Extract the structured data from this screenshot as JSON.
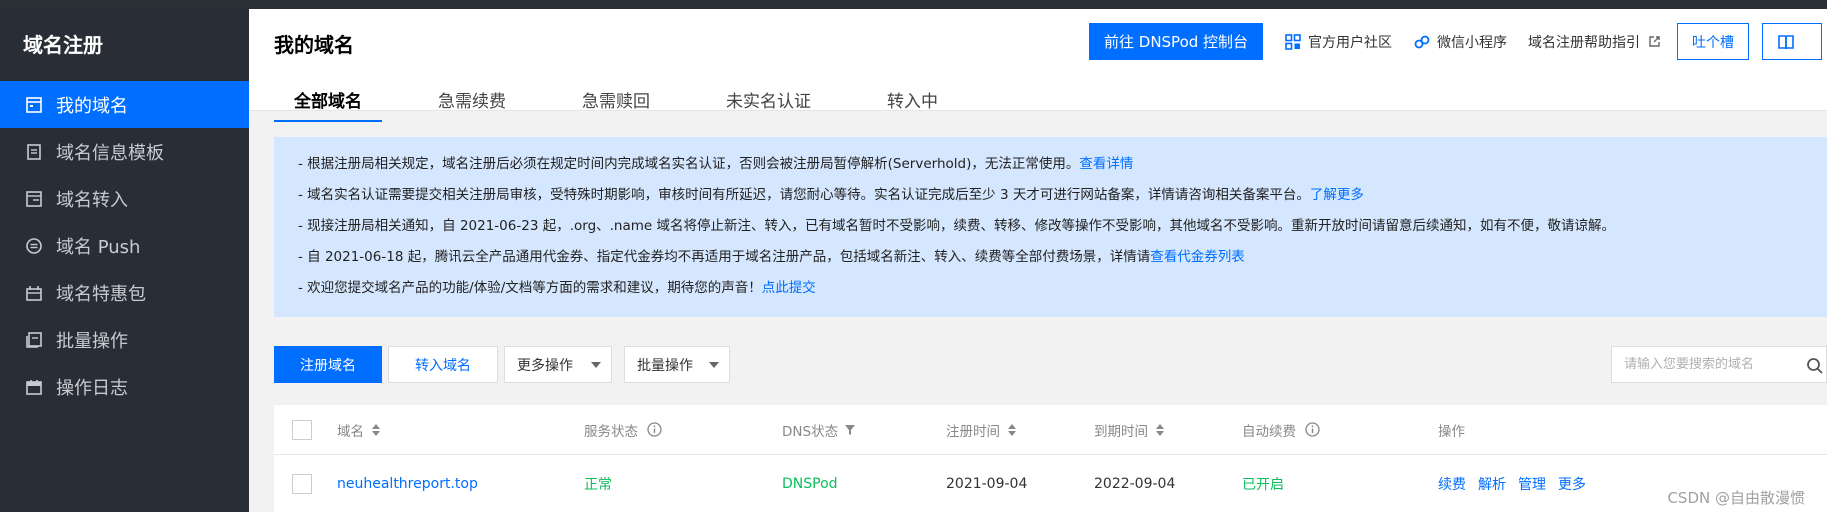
{
  "sidebar": {
    "title": "域名注册",
    "items": [
      {
        "label": "我的域名",
        "icon": "domain-list-icon",
        "active": true
      },
      {
        "label": "域名信息模板",
        "icon": "document-icon",
        "active": false
      },
      {
        "label": "域名转入",
        "icon": "transfer-icon",
        "active": false
      },
      {
        "label": "域名 Push",
        "icon": "push-icon",
        "active": false
      },
      {
        "label": "域名特惠包",
        "icon": "gift-icon",
        "active": false
      },
      {
        "label": "批量操作",
        "icon": "batch-icon",
        "active": false
      },
      {
        "label": "操作日志",
        "icon": "calendar-icon",
        "active": false
      }
    ]
  },
  "header": {
    "title": "我的域名",
    "tabs": [
      "全部域名",
      "急需续费",
      "急需赎回",
      "未实名认证",
      "转入中"
    ],
    "active_tab": 0,
    "dnspod_button": "前往 DNSPod 控制台",
    "community_link": "官方用户社区",
    "miniprogram_link": "微信小程序",
    "help_link": "域名注册帮助指引",
    "feedback_button": "吐个槽"
  },
  "notice": {
    "lines": [
      {
        "text": "- 根据注册局相关规定，域名注册后必须在规定时间内完成域名实名认证，否则会被注册局暂停解析(Serverhold)，无法正常使用。",
        "link": "查看详情"
      },
      {
        "text": "- 域名实名认证需要提交相关注册局审核，受特殊时期影响，审核时间有所延迟，请您耐心等待。实名认证完成后至少 3 天才可进行网站备案，详情请咨询相关备案平台。",
        "link": "了解更多"
      },
      {
        "text": "- 现接注册局相关通知，自 2021-06-23 起，.org、.name 域名将停止新注、转入，已有域名暂时不受影响，续费、转移、修改等操作不受影响，其他域名不受影响。重新开放时间请留意后续通知，如有不便，敬请谅解。",
        "link": ""
      },
      {
        "text": "- 自 2021-06-18 起，腾讯云全产品通用代金券、指定代金券均不再适用于域名注册产品，包括域名新注、转入、续费等全部付费场景，详情请",
        "link": "查看代金券列表"
      },
      {
        "text": "- 欢迎您提交域名产品的功能/体验/文档等方面的需求和建议，期待您的声音！",
        "link": "点此提交"
      }
    ]
  },
  "toolbar": {
    "register_button": "注册域名",
    "transfer_button": "转入域名",
    "more_ops_select": "更多操作",
    "batch_ops_select": "批量操作",
    "search_placeholder": "请输入您要搜索的域名"
  },
  "table": {
    "columns": {
      "domain": "域名",
      "service_status": "服务状态",
      "dns_status": "DNS状态",
      "register_time": "注册时间",
      "expire_time": "到期时间",
      "auto_renew": "自动续费",
      "actions": "操作"
    },
    "rows": [
      {
        "domain": "neuhealthreport.top",
        "service_status": "正常",
        "dns_status": "DNSPod",
        "register_time": "2021-09-04",
        "expire_time": "2022-09-04",
        "auto_renew": "已开启",
        "actions": [
          "续费",
          "解析",
          "管理",
          "更多"
        ]
      }
    ]
  },
  "watermark": "CSDN @自由散漫惯",
  "colors": {
    "accent": "#006eff",
    "sidebar_bg": "#292d35",
    "notice_bg": "#d5e7fe",
    "success": "#0abf5b"
  }
}
